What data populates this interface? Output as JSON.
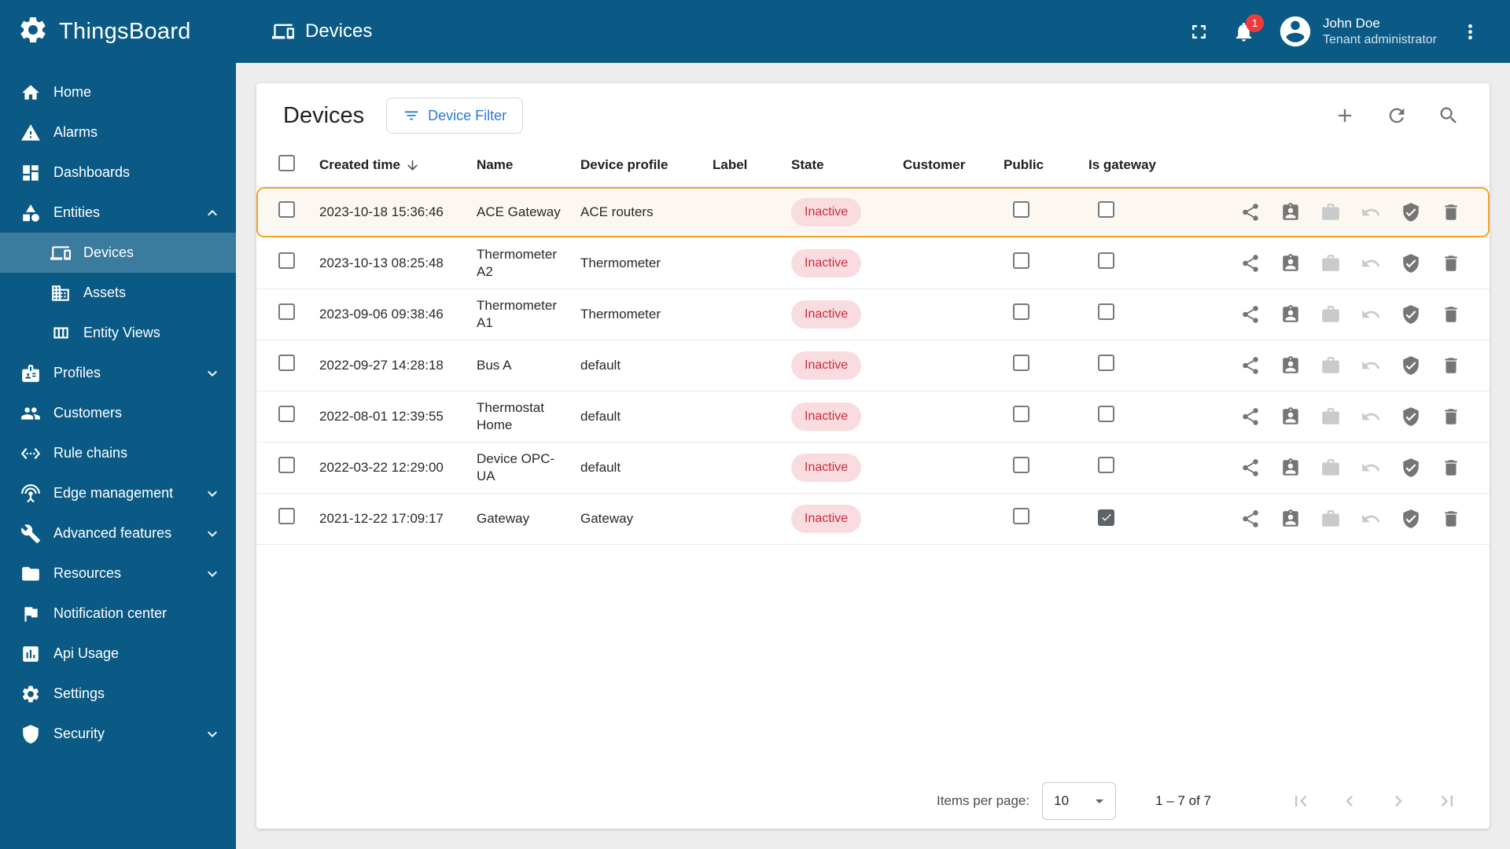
{
  "colors": {
    "primary": "#0a5a85",
    "sidebar_selected": "rgba(255,255,255,0.2)",
    "accent_blue": "#2a7cd4",
    "row_highlight_border": "#f0a22e",
    "state_inactive_text": "#d02b36",
    "state_inactive_bg": "#f9dce0",
    "notification_badge": "#f23a3a"
  },
  "brand": {
    "name": "ThingsBoard"
  },
  "header": {
    "title": "Devices",
    "notification_badge": "1",
    "user": {
      "name": "John Doe",
      "role": "Tenant administrator"
    }
  },
  "sidebar": {
    "items": [
      {
        "label": "Home",
        "icon": "home"
      },
      {
        "label": "Alarms",
        "icon": "alarms"
      },
      {
        "label": "Dashboards",
        "icon": "dashboards"
      },
      {
        "label": "Entities",
        "icon": "entities",
        "expanded": true
      },
      {
        "label": "Devices",
        "icon": "devices",
        "child": true,
        "selected": true
      },
      {
        "label": "Assets",
        "icon": "assets",
        "child": true
      },
      {
        "label": "Entity Views",
        "icon": "entity-views",
        "child": true
      },
      {
        "label": "Profiles",
        "icon": "profiles",
        "collapsible": true
      },
      {
        "label": "Customers",
        "icon": "customers"
      },
      {
        "label": "Rule chains",
        "icon": "rule-chains"
      },
      {
        "label": "Edge management",
        "icon": "edge-management",
        "collapsible": true
      },
      {
        "label": "Advanced features",
        "icon": "advanced-features",
        "collapsible": true
      },
      {
        "label": "Resources",
        "icon": "resources",
        "collapsible": true
      },
      {
        "label": "Notification center",
        "icon": "notification-center"
      },
      {
        "label": "Api Usage",
        "icon": "api-usage"
      },
      {
        "label": "Settings",
        "icon": "settings"
      },
      {
        "label": "Security",
        "icon": "security",
        "collapsible": true
      }
    ]
  },
  "content": {
    "title": "Devices",
    "filter_button_label": "Device Filter",
    "table": {
      "columns": [
        "Created time",
        "Name",
        "Device profile",
        "Label",
        "State",
        "Customer",
        "Public",
        "Is gateway"
      ],
      "sort": {
        "column": "Created time",
        "direction": "desc"
      },
      "rows": [
        {
          "created_time": "2023-10-18 15:36:46",
          "name": "ACE Gateway",
          "device_profile": "ACE routers",
          "label": "",
          "state": "Inactive",
          "customer": "",
          "public": false,
          "is_gateway": false,
          "highlighted": true
        },
        {
          "created_time": "2023-10-13 08:25:48",
          "name": "Thermometer A2",
          "device_profile": "Thermometer",
          "label": "",
          "state": "Inactive",
          "customer": "",
          "public": false,
          "is_gateway": false
        },
        {
          "created_time": "2023-09-06 09:38:46",
          "name": "Thermometer A1",
          "device_profile": "Thermometer",
          "label": "",
          "state": "Inactive",
          "customer": "",
          "public": false,
          "is_gateway": false
        },
        {
          "created_time": "2022-09-27 14:28:18",
          "name": "Bus A",
          "device_profile": "default",
          "label": "",
          "state": "Inactive",
          "customer": "",
          "public": false,
          "is_gateway": false
        },
        {
          "created_time": "2022-08-01 12:39:55",
          "name": "Thermostat Home",
          "device_profile": "default",
          "label": "",
          "state": "Inactive",
          "customer": "",
          "public": false,
          "is_gateway": false
        },
        {
          "created_time": "2022-03-22 12:29:00",
          "name": "Device OPC-UA",
          "device_profile": "default",
          "label": "",
          "state": "Inactive",
          "customer": "",
          "public": false,
          "is_gateway": false
        },
        {
          "created_time": "2021-12-22 17:09:17",
          "name": "Gateway",
          "device_profile": "Gateway",
          "label": "",
          "state": "Inactive",
          "customer": "",
          "public": false,
          "is_gateway": true
        }
      ],
      "row_actions": [
        {
          "icon": "share-icon",
          "glyph": "share",
          "enabled": true
        },
        {
          "icon": "assign-to-customer-icon",
          "glyph": "assign",
          "enabled": true
        },
        {
          "icon": "manage-owner-icon",
          "glyph": "work",
          "enabled": false
        },
        {
          "icon": "unassign-from-customer-icon",
          "glyph": "undo",
          "enabled": false
        },
        {
          "icon": "manage-credentials-icon",
          "glyph": "shield-check",
          "enabled": true
        },
        {
          "icon": "delete-icon",
          "glyph": "delete",
          "enabled": true
        }
      ]
    },
    "pagination": {
      "items_per_page_label": "Items per page:",
      "items_per_page": "10",
      "range": "1 – 7 of 7"
    }
  }
}
